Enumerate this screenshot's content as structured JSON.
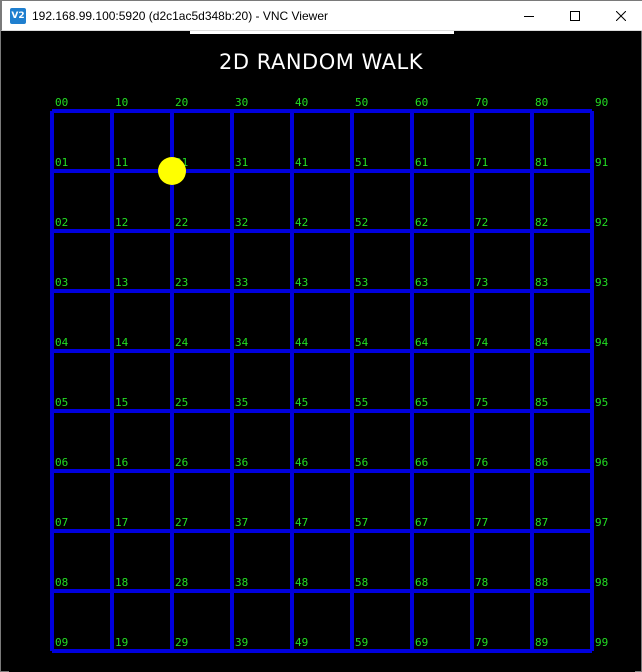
{
  "window": {
    "icon_text": "V2",
    "title": "192.168.99.100:5920 (d2c1ac5d348b:20) - VNC Viewer",
    "buttons": {
      "minimize": "minimize",
      "maximize": "maximize",
      "close": "close"
    }
  },
  "app": {
    "heading": "2D RANDOM WALK",
    "grid_color": "#0000dd",
    "label_color": "#22dd22",
    "walker_color": "#ffff00",
    "walker_cell": {
      "col": 2,
      "row": 1
    },
    "columns": 9,
    "rows": 9,
    "labels": [
      [
        "00",
        "01",
        "02",
        "03",
        "04",
        "05",
        "06",
        "07",
        "08",
        "09"
      ],
      [
        "10",
        "11",
        "12",
        "13",
        "14",
        "15",
        "16",
        "17",
        "18",
        "19"
      ],
      [
        "20",
        "21",
        "22",
        "23",
        "24",
        "25",
        "26",
        "27",
        "28",
        "29"
      ],
      [
        "30",
        "31",
        "32",
        "33",
        "34",
        "35",
        "36",
        "37",
        "38",
        "39"
      ],
      [
        "40",
        "41",
        "42",
        "43",
        "44",
        "45",
        "46",
        "47",
        "48",
        "49"
      ],
      [
        "50",
        "51",
        "52",
        "53",
        "54",
        "55",
        "56",
        "57",
        "58",
        "59"
      ],
      [
        "60",
        "61",
        "62",
        "63",
        "64",
        "65",
        "66",
        "67",
        "68",
        "69"
      ],
      [
        "70",
        "71",
        "72",
        "73",
        "74",
        "75",
        "76",
        "77",
        "78",
        "79"
      ],
      [
        "80",
        "81",
        "82",
        "83",
        "84",
        "85",
        "86",
        "87",
        "88",
        "89"
      ],
      [
        "90",
        "91",
        "92",
        "93",
        "94",
        "95",
        "96",
        "97",
        "98",
        "99"
      ]
    ]
  }
}
